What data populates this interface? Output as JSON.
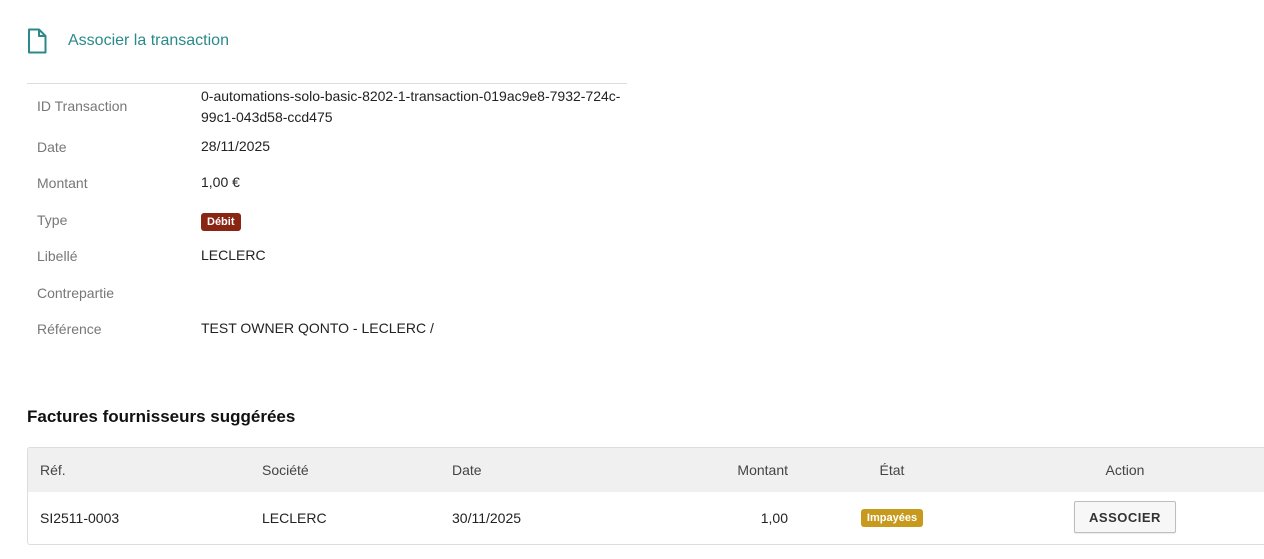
{
  "header": {
    "icon": "document-icon",
    "title": "Associer la transaction",
    "accent_color": "#2a8a8a"
  },
  "details": [
    {
      "label": "ID Transaction",
      "value": "0-automations-solo-basic-8202-1-transaction-019ac9e8-7932-724c-99c1-043d58-ccd475"
    },
    {
      "label": "Date",
      "value": "28/11/2025"
    },
    {
      "label": "Montant",
      "value": "1,00 €"
    },
    {
      "label": "Type",
      "value": "Débit",
      "badge_color": "#8b2513"
    },
    {
      "label": "Libellé",
      "value": "LECLERC"
    },
    {
      "label": "Contrepartie",
      "value": ""
    },
    {
      "label": "Référence",
      "value": "TEST OWNER QONTO - LECLERC /"
    }
  ],
  "suggestions": {
    "title": "Factures fournisseurs suggérées",
    "columns": [
      "Réf.",
      "Société",
      "Date",
      "Montant",
      "État",
      "Action"
    ],
    "rows": [
      {
        "ref": "SI2511-0003",
        "societe": "LECLERC",
        "date": "30/11/2025",
        "montant": "1,00",
        "etat": "Impayées",
        "etat_color": "#c79a1d",
        "action_label": "ASSOCIER"
      }
    ]
  }
}
